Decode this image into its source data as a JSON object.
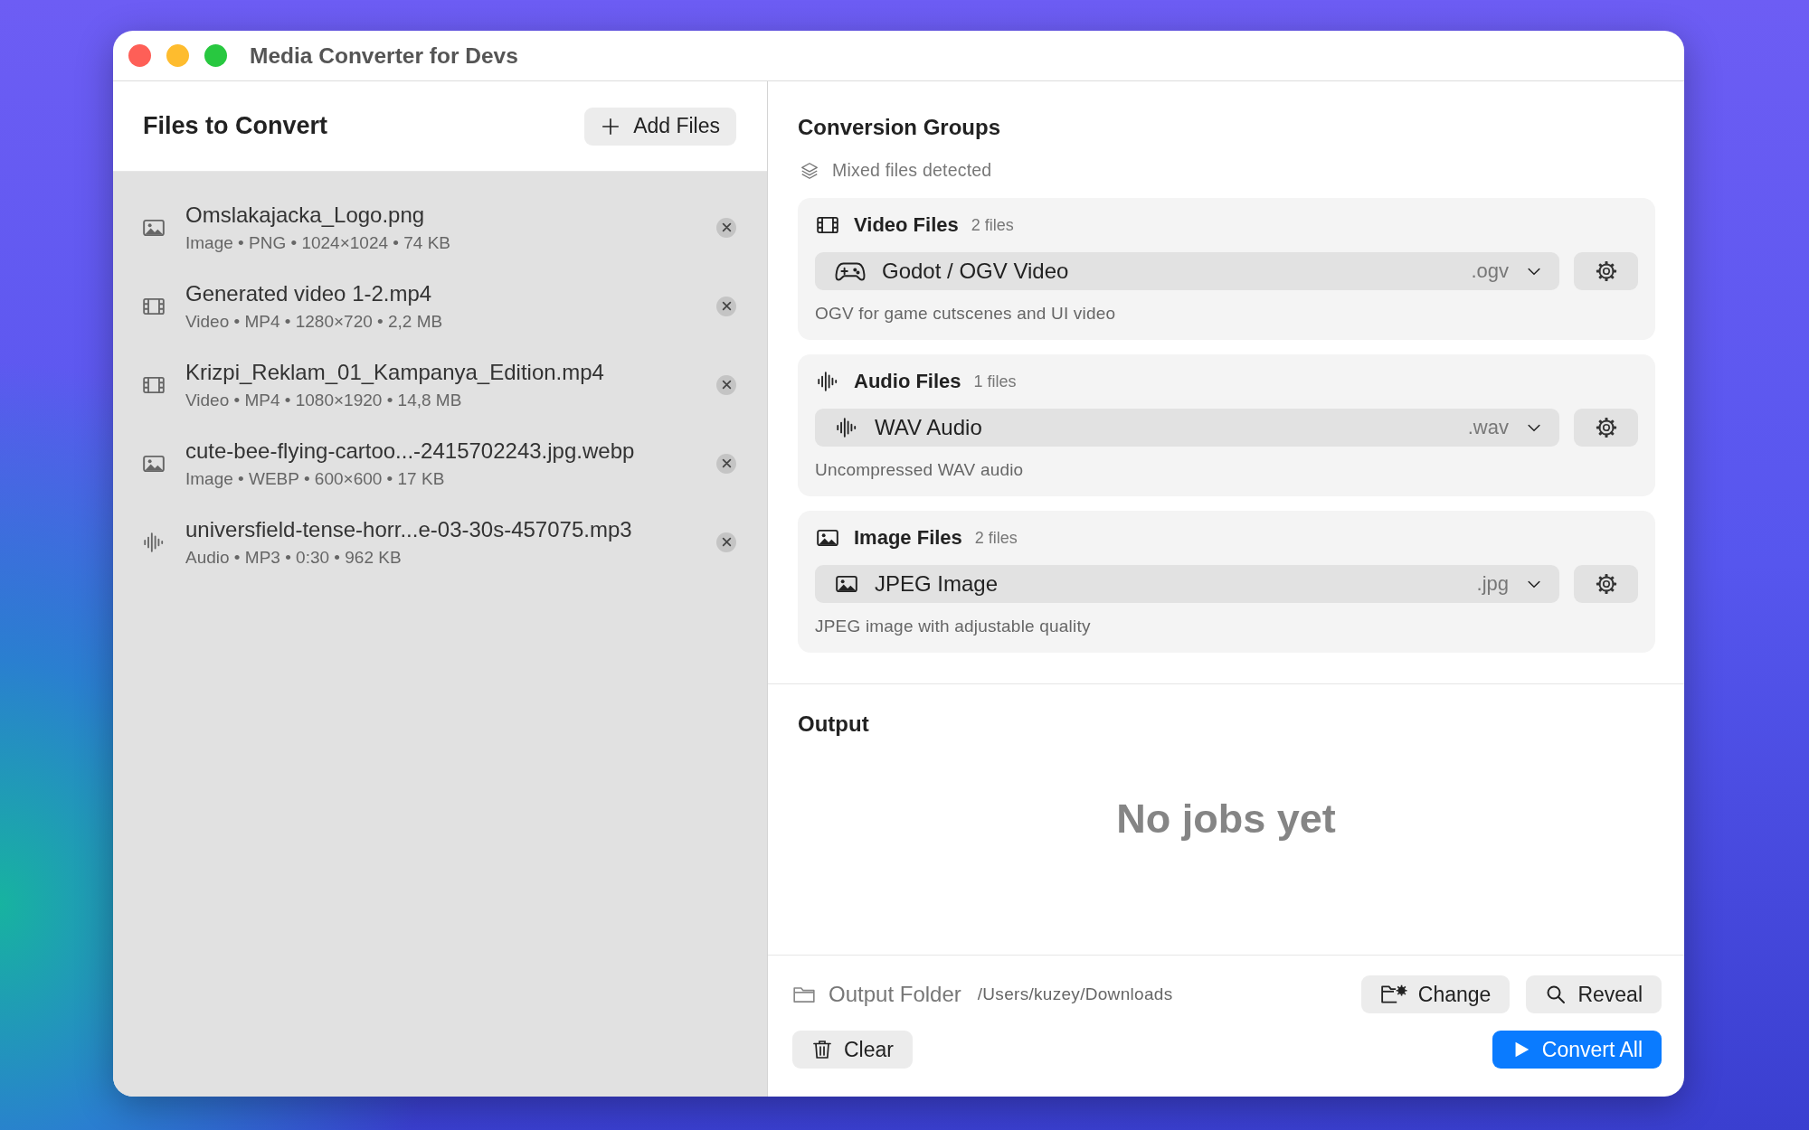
{
  "window": {
    "title": "Media Converter for Devs"
  },
  "files_panel": {
    "title": "Files to Convert",
    "add_button": "Add Files",
    "files": [
      {
        "kind": "image",
        "name": "Omslakajacka_Logo.png",
        "meta": "Image • PNG • 1024×1024 • 74 KB"
      },
      {
        "kind": "video",
        "name": "Generated video 1-2.mp4",
        "meta": "Video • MP4 • 1280×720 • 2,2 MB"
      },
      {
        "kind": "video",
        "name": "Krizpi_Reklam_01_Kampanya_Edition.mp4",
        "meta": "Video • MP4 • 1080×1920 • 14,8 MB"
      },
      {
        "kind": "image",
        "name": "cute-bee-flying-cartoo...-2415702243.jpg.webp",
        "meta": "Image • WEBP • 600×600 • 17 KB"
      },
      {
        "kind": "audio",
        "name": "universfield-tense-horr...e-03-30s-457075.mp3",
        "meta": "Audio • MP3 • 0:30 • 962 KB"
      }
    ]
  },
  "conversion_groups": {
    "title": "Conversion Groups",
    "notice": "Mixed files detected",
    "groups": [
      {
        "kind": "video",
        "title": "Video Files",
        "count": "2 files",
        "format": {
          "kind": "gamepad",
          "label": "Godot / OGV Video",
          "extension": ".ogv"
        },
        "description": "OGV for game cutscenes and UI video"
      },
      {
        "kind": "audio",
        "title": "Audio Files",
        "count": "1 files",
        "format": {
          "kind": "audio",
          "label": "WAV Audio",
          "extension": ".wav"
        },
        "description": "Uncompressed WAV audio"
      },
      {
        "kind": "image",
        "title": "Image Files",
        "count": "2 files",
        "format": {
          "kind": "image",
          "label": "JPEG Image",
          "extension": ".jpg"
        },
        "description": "JPEG image with adjustable quality"
      }
    ]
  },
  "output": {
    "title": "Output",
    "empty_message": "No jobs yet"
  },
  "footer": {
    "folder_label": "Output Folder",
    "folder_path": "/Users/kuzey/Downloads",
    "change_button": "Change",
    "reveal_button": "Reveal",
    "clear_button": "Clear",
    "convert_button": "Convert All"
  }
}
